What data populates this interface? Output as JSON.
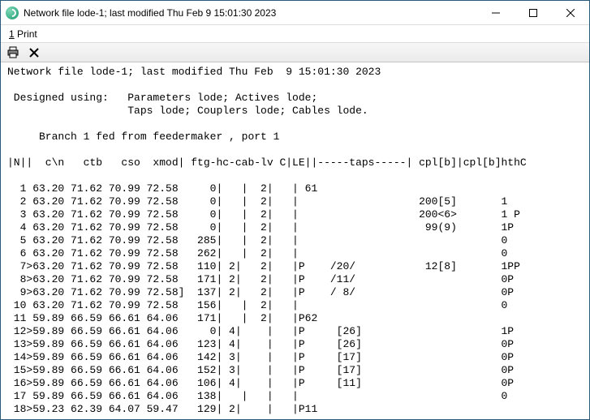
{
  "window": {
    "title": "Network file lode-1; last modified Thu Feb  9 15:01:30 2023"
  },
  "menubar": {
    "print_underline": "1",
    "print_rest": " Print"
  },
  "toolbar": {
    "print_icon": "printer-icon",
    "close_icon": "close-icon"
  },
  "report": {
    "header_line": "Network file lode-1; last modified Thu Feb  9 15:01:30 2023",
    "designed_line1": " Designed using:   Parameters lode; Actives lode;",
    "designed_line2": "                   Taps lode; Couplers lode; Cables lode.",
    "branch_line": "     Branch 1 fed from feedermaker , port 1",
    "col_header": "|N||  c\\n   ctb   cso  xmod| ftg-hc-cab-lv C|LE||-----taps-----| cpl[b]|cpl[b]hthC",
    "rows": [
      "  1 63.20 71.62 70.99 72.58     0|   |  2|   | 61",
      "  2 63.20 71.62 70.99 72.58     0|   |  2|   |                   200[5]       1",
      "  3 63.20 71.62 70.99 72.58     0|   |  2|   |                   200<6>       1 P",
      "  4 63.20 71.62 70.99 72.58     0|   |  2|   |                    99(9)       1P",
      "  5 63.20 71.62 70.99 72.58   285|   |  2|   |                                0",
      "  6 63.20 71.62 70.99 72.58   262|   |  2|   |                                0",
      "  7>63.20 71.62 70.99 72.58   110| 2|   2|   |P    /20/           12[8]       1PP",
      "  8>63.20 71.62 70.99 72.58   171| 2|   2|   |P    /11/                       0P",
      "  9>63.20 71.62 70.99 72.58]  137| 2|   2|   |P    / 8/                       0P",
      " 10 63.20 71.62 70.99 72.58   156|   |  2|   |                                0",
      " 11 59.89 66.59 66.61 64.06   171|   |  2|   |P62",
      " 12>59.89 66.59 66.61 64.06     0| 4|    |   |P     [26]                      1P",
      " 13>59.89 66.59 66.61 64.06   123| 4|    |   |P     [26]                      0P",
      " 14>59.89 66.59 66.61 64.06   142| 3|    |   |P     [17]                      0P",
      " 15>59.89 66.59 66.61 64.06   152| 3|    |   |P     [17]                      0P",
      " 16>59.89 66.59 66.61 64.06   106| 4|    |   |P     [11]                      0P",
      " 17 59.89 66.59 66.61 64.06   138|   |   |   |                                0",
      " 18>59.23 62.39 64.07 59.47   129| 2|    |   |P11"
    ]
  },
  "chart_data": {
    "type": "table",
    "columns": [
      "N",
      "c\\n",
      "ctb",
      "cso",
      "xmod",
      "ftg",
      "hc",
      "cab",
      "lv",
      "C",
      "LE",
      "taps",
      "cpl[b]",
      "cpl[b]hthC"
    ],
    "rows": [
      {
        "N": 1,
        "cn": 63.2,
        "ctb": 71.62,
        "cso": 70.99,
        "xmod": 72.58,
        "ftg": 0,
        "hc": "",
        "cab": 2,
        "lv": "",
        "C": "",
        "LE": "",
        "taps": "61",
        "cplb": "",
        "cplbhthC": ""
      },
      {
        "N": 2,
        "cn": 63.2,
        "ctb": 71.62,
        "cso": 70.99,
        "xmod": 72.58,
        "ftg": 0,
        "hc": "",
        "cab": 2,
        "lv": "",
        "C": "",
        "LE": "",
        "taps": "",
        "cplb": "200[5]",
        "cplbhthC": "1"
      },
      {
        "N": 3,
        "cn": 63.2,
        "ctb": 71.62,
        "cso": 70.99,
        "xmod": 72.58,
        "ftg": 0,
        "hc": "",
        "cab": 2,
        "lv": "",
        "C": "",
        "LE": "",
        "taps": "",
        "cplb": "200<6>",
        "cplbhthC": "1 P"
      },
      {
        "N": 4,
        "cn": 63.2,
        "ctb": 71.62,
        "cso": 70.99,
        "xmod": 72.58,
        "ftg": 0,
        "hc": "",
        "cab": 2,
        "lv": "",
        "C": "",
        "LE": "",
        "taps": "",
        "cplb": "99(9)",
        "cplbhthC": "1P"
      },
      {
        "N": 5,
        "cn": 63.2,
        "ctb": 71.62,
        "cso": 70.99,
        "xmod": 72.58,
        "ftg": 285,
        "hc": "",
        "cab": 2,
        "lv": "",
        "C": "",
        "LE": "",
        "taps": "",
        "cplb": "",
        "cplbhthC": "0"
      },
      {
        "N": 6,
        "cn": 63.2,
        "ctb": 71.62,
        "cso": 70.99,
        "xmod": 72.58,
        "ftg": 262,
        "hc": "",
        "cab": 2,
        "lv": "",
        "C": "",
        "LE": "",
        "taps": "",
        "cplb": "",
        "cplbhthC": "0"
      },
      {
        "N": 7,
        "cn": 63.2,
        "ctb": 71.62,
        "cso": 70.99,
        "xmod": 72.58,
        "ftg": 110,
        "hc": 2,
        "cab": 2,
        "lv": "",
        "C": "",
        "LE": "P",
        "taps": "/20/",
        "cplb": "12[8]",
        "cplbhthC": "1PP"
      },
      {
        "N": 8,
        "cn": 63.2,
        "ctb": 71.62,
        "cso": 70.99,
        "xmod": 72.58,
        "ftg": 171,
        "hc": 2,
        "cab": 2,
        "lv": "",
        "C": "",
        "LE": "P",
        "taps": "/11/",
        "cplb": "",
        "cplbhthC": "0P"
      },
      {
        "N": 9,
        "cn": 63.2,
        "ctb": 71.62,
        "cso": 70.99,
        "xmod": "72.58]",
        "ftg": 137,
        "hc": 2,
        "cab": 2,
        "lv": "",
        "C": "",
        "LE": "P",
        "taps": "/ 8/",
        "cplb": "",
        "cplbhthC": "0P"
      },
      {
        "N": 10,
        "cn": 63.2,
        "ctb": 71.62,
        "cso": 70.99,
        "xmod": 72.58,
        "ftg": 156,
        "hc": "",
        "cab": 2,
        "lv": "",
        "C": "",
        "LE": "",
        "taps": "",
        "cplb": "",
        "cplbhthC": "0"
      },
      {
        "N": 11,
        "cn": 59.89,
        "ctb": 66.59,
        "cso": 66.61,
        "xmod": 64.06,
        "ftg": 171,
        "hc": "",
        "cab": 2,
        "lv": "",
        "C": "",
        "LE": "P62",
        "taps": "",
        "cplb": "",
        "cplbhthC": ""
      },
      {
        "N": 12,
        "cn": 59.89,
        "ctb": 66.59,
        "cso": 66.61,
        "xmod": 64.06,
        "ftg": 0,
        "hc": 4,
        "cab": "",
        "lv": "",
        "C": "",
        "LE": "P",
        "taps": "[26]",
        "cplb": "",
        "cplbhthC": "1P"
      },
      {
        "N": 13,
        "cn": 59.89,
        "ctb": 66.59,
        "cso": 66.61,
        "xmod": 64.06,
        "ftg": 123,
        "hc": 4,
        "cab": "",
        "lv": "",
        "C": "",
        "LE": "P",
        "taps": "[26]",
        "cplb": "",
        "cplbhthC": "0P"
      },
      {
        "N": 14,
        "cn": 59.89,
        "ctb": 66.59,
        "cso": 66.61,
        "xmod": 64.06,
        "ftg": 142,
        "hc": 3,
        "cab": "",
        "lv": "",
        "C": "",
        "LE": "P",
        "taps": "[17]",
        "cplb": "",
        "cplbhthC": "0P"
      },
      {
        "N": 15,
        "cn": 59.89,
        "ctb": 66.59,
        "cso": 66.61,
        "xmod": 64.06,
        "ftg": 152,
        "hc": 3,
        "cab": "",
        "lv": "",
        "C": "",
        "LE": "P",
        "taps": "[17]",
        "cplb": "",
        "cplbhthC": "0P"
      },
      {
        "N": 16,
        "cn": 59.89,
        "ctb": 66.59,
        "cso": 66.61,
        "xmod": 64.06,
        "ftg": 106,
        "hc": 4,
        "cab": "",
        "lv": "",
        "C": "",
        "LE": "P",
        "taps": "[11]",
        "cplb": "",
        "cplbhthC": "0P"
      },
      {
        "N": 17,
        "cn": 59.89,
        "ctb": 66.59,
        "cso": 66.61,
        "xmod": 64.06,
        "ftg": 138,
        "hc": "",
        "cab": "",
        "lv": "",
        "C": "",
        "LE": "",
        "taps": "",
        "cplb": "",
        "cplbhthC": "0"
      },
      {
        "N": 18,
        "cn": 59.23,
        "ctb": 62.39,
        "cso": 64.07,
        "xmod": 59.47,
        "ftg": 129,
        "hc": 2,
        "cab": "",
        "lv": "",
        "C": "",
        "LE": "P11",
        "taps": "",
        "cplb": "",
        "cplbhthC": ""
      }
    ]
  }
}
